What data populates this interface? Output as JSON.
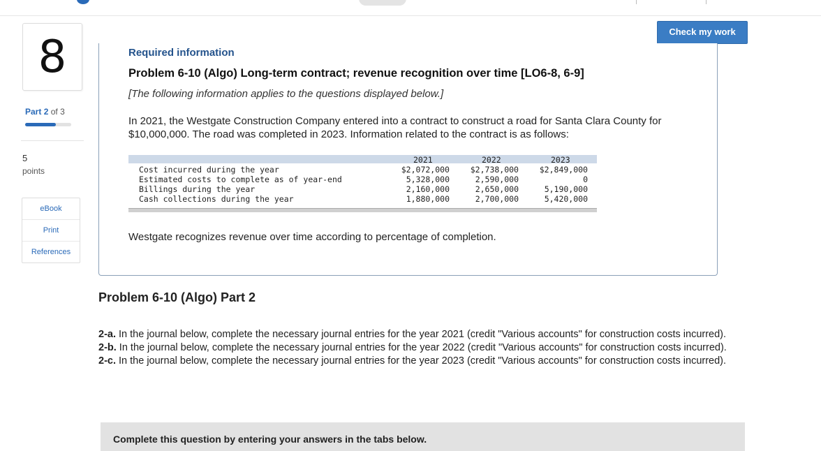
{
  "question": {
    "number": "8"
  },
  "part": {
    "current": "2",
    "total": "3",
    "part_word": "Part",
    "of_word": "of",
    "progress_fraction": 0.667
  },
  "points": {
    "value": "5",
    "label": "points"
  },
  "side_links": [
    "eBook",
    "Print",
    "References"
  ],
  "check_button": "Check my work",
  "required": {
    "heading": "Required information",
    "problem_title": "Problem 6-10 (Algo) Long-term contract; revenue recognition over time [LO6-8, 6-9]",
    "note": "[The following information applies to the questions displayed below.]",
    "intro": "In 2021, the Westgate Construction Company entered into a contract to construct a road for Santa Clara County for $10,000,000. The road was completed in 2023. Information related to the contract is as follows:",
    "table": {
      "years": [
        "2021",
        "2022",
        "2023"
      ],
      "rows": [
        {
          "label": "Cost incurred during the year",
          "values": [
            "$2,072,000",
            "$2,738,000",
            "$2,849,000"
          ]
        },
        {
          "label": "Estimated costs to complete as of year-end",
          "values": [
            "5,328,000",
            "2,590,000",
            "0"
          ]
        },
        {
          "label": "Billings during the year",
          "values": [
            "2,160,000",
            "2,650,000",
            "5,190,000"
          ]
        },
        {
          "label": "Cash collections during the year",
          "values": [
            "1,880,000",
            "2,700,000",
            "5,420,000"
          ]
        }
      ]
    },
    "revenue_note": "Westgate recognizes revenue over time according to percentage of completion."
  },
  "part2": {
    "title": "Problem 6-10 (Algo) Part 2",
    "instructions": [
      {
        "label": "2-a.",
        "text": " In the journal below, complete the necessary journal entries for the year 2021 (credit \"Various accounts\" for construction costs incurred)."
      },
      {
        "label": "2-b.",
        "text": " In the journal below, complete the necessary journal entries for the year 2022 (credit \"Various accounts\" for construction costs incurred)."
      },
      {
        "label": "2-c.",
        "text": " In the journal below, complete the necessary journal entries for the year 2023 (credit \"Various accounts\" for construction costs incurred)."
      }
    ],
    "complete_banner": "Complete this question by entering your answers in the tabs below."
  },
  "colors": {
    "accent": "#2a6ab8",
    "button": "#3b7dc4",
    "heading_blue": "#24538c",
    "table_header": "#cdd9e8"
  }
}
